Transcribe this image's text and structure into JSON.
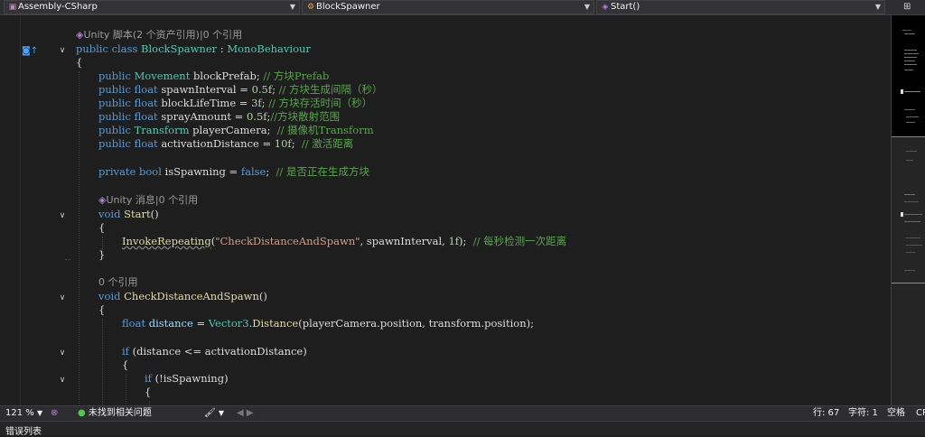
{
  "nav": {
    "project": "Assembly-CSharp",
    "class_name": "BlockSpawner",
    "member": "Start()",
    "project_icon": "csharp-project-icon",
    "class_icon": "class-icon",
    "member_icon": "method-icon"
  },
  "code": {
    "line1_lens": "Unity 脚本(2 个资产引用)|0 个引用",
    "l2_public": "public",
    "l2_class": "class",
    "l2_name": "BlockSpawner",
    "l2_colon": " : ",
    "l2_base": "MonoBehaviour",
    "l3": "{",
    "f1_public": "public",
    "f1_type": "Movement",
    "f1_rest": " blockPrefab; ",
    "f1_cm": "// 方块Prefab",
    "f2_public": "public",
    "f2_type": "float",
    "f2_rest": " spawnInterval = ",
    "f2_num": "0.5f",
    "f2_semi": "; ",
    "f2_cm": "// 方块生成间隔（秒）",
    "f3_public": "public",
    "f3_type": "float",
    "f3_rest": " blockLifeTime = ",
    "f3_num": "3f",
    "f3_semi": "; ",
    "f3_cm": "// 方块存活时间（秒）",
    "f4_public": "public",
    "f4_type": "float",
    "f4_rest": " sprayAmount = ",
    "f4_num": "0.5f",
    "f4_semi": ";",
    "f4_cm": "//方块散射范围",
    "f5_public": "public",
    "f5_type": "Transform",
    "f5_rest": " playerCamera;  ",
    "f5_cm": "// 摄像机Transform",
    "f6_public": "public",
    "f6_type": "float",
    "f6_rest": " activationDistance = ",
    "f6_num": "10f",
    "f6_semi": ";  ",
    "f6_cm": "// 激活距离",
    "p1_private": "private",
    "p1_type": "bool",
    "p1_rest": " isSpawning = ",
    "p1_false": "false",
    "p1_semi": ";  ",
    "p1_cm": "// 是否正在生成方块",
    "start_lens": "Unity 消息|0 个引用",
    "start_void": "void",
    "start_name": "Start",
    "start_paren": "()",
    "start_open": "{",
    "inv_name": "InvokeRepeating",
    "inv_p1": "(",
    "inv_str": "\"CheckDistanceAndSpawn\"",
    "inv_p2": ", spawnInterval, ",
    "inv_num": "1f",
    "inv_p3": ");  ",
    "inv_cm": "// 每秒检测一次距离",
    "start_close": "}",
    "check_lens": "0 个引用",
    "check_void": "void",
    "check_name": "CheckDistanceAndSpawn",
    "check_paren": "()",
    "check_open": "{",
    "dist_type": "float",
    "dist_var": " distance",
    "dist_eq": " = ",
    "dist_cls": "Vector3",
    "dist_dot": ".",
    "dist_m": "Distance",
    "dist_args": "(playerCamera.position, transform.position);",
    "if_kw": "if",
    "if_rest": " (distance <= activationDistance)",
    "if_open": "{",
    "if2_kw": "if",
    "if2_rest": " (!isSpawning)",
    "if2_open": "{"
  },
  "status": {
    "zoom": "121 %",
    "issues": "未找到相关问题",
    "line": "行: 67",
    "char": "字符: 1",
    "spaces": "空格",
    "encoding": "CR"
  },
  "bottom_panel": {
    "tab": "错误列表"
  },
  "colors": {
    "keyword": "#569cd6",
    "type": "#4ec9b0",
    "comment": "#57a64a",
    "string": "#d69d85",
    "method": "#dcdcaa",
    "number": "#b5cea8"
  }
}
